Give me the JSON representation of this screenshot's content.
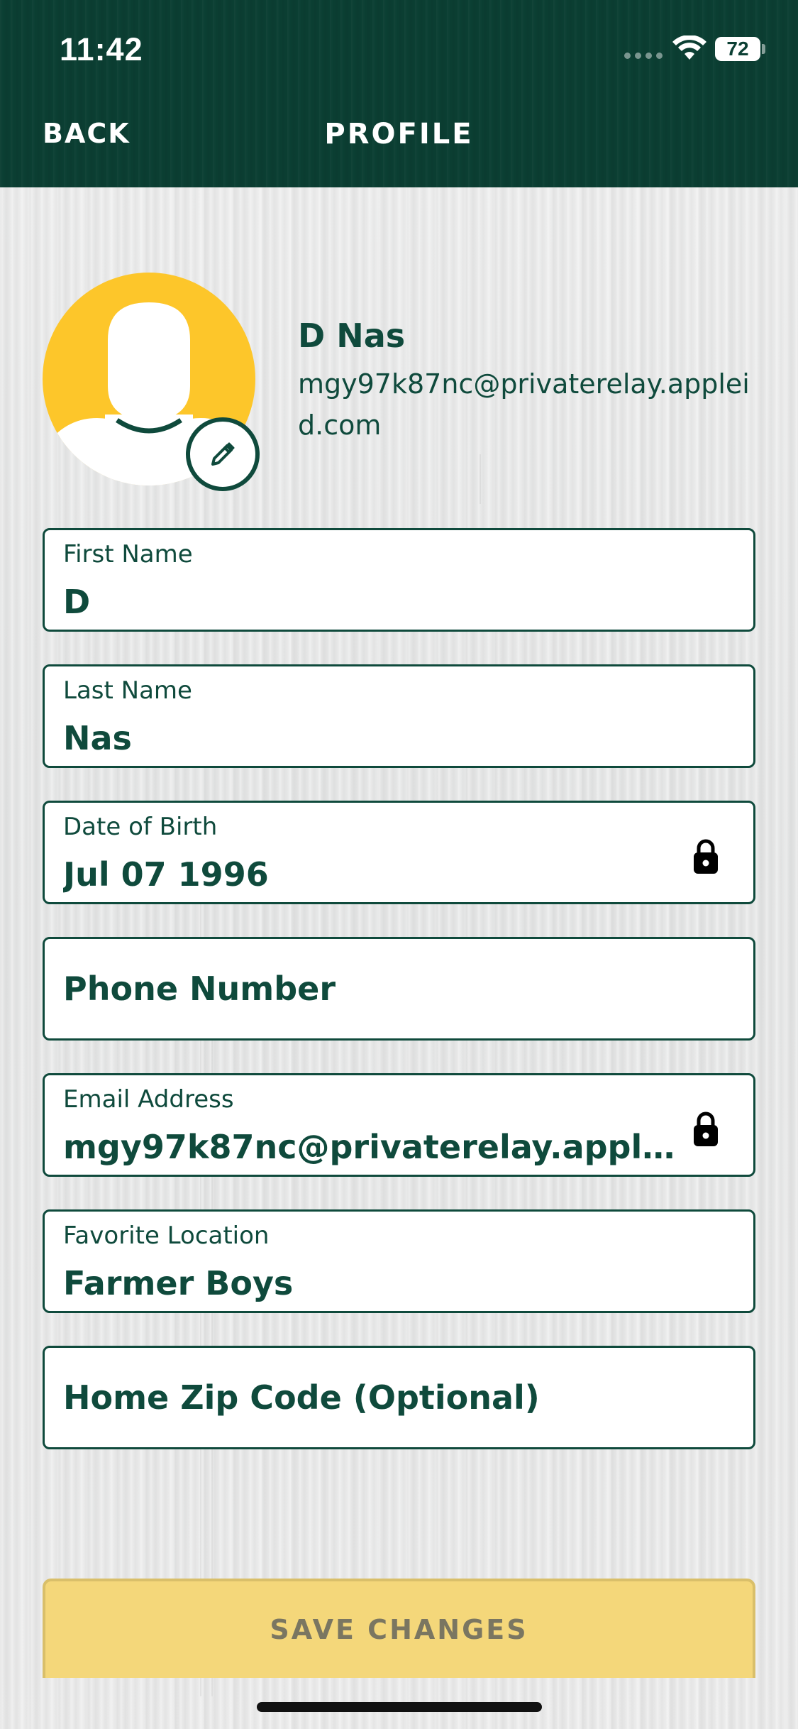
{
  "status_bar": {
    "time": "11:42",
    "battery": "72",
    "signal_icon": "cellular-signal-icon",
    "wifi_icon": "wifi-icon"
  },
  "nav": {
    "back_label": "BACK",
    "title": "PROFILE"
  },
  "profile": {
    "name": "D Nas",
    "email": "mgy97k87nc@privaterelay.appleid.com",
    "avatar_icon": "default-avatar-icon",
    "edit_icon": "pencil-icon"
  },
  "fields": {
    "first_name": {
      "label": "First Name",
      "value": "D"
    },
    "last_name": {
      "label": "Last Name",
      "value": "Nas"
    },
    "dob": {
      "label": "Date of Birth",
      "value": "Jul 07 1996",
      "locked": true
    },
    "phone": {
      "placeholder": "Phone Number"
    },
    "email": {
      "label": "Email Address",
      "value": "mgy97k87nc@privaterelay.appleid.com",
      "locked": true
    },
    "favorite_location": {
      "label": "Favorite Location",
      "value": "Farmer Boys"
    },
    "zip": {
      "placeholder": "Home Zip Code (Optional)"
    }
  },
  "actions": {
    "save_label": "SAVE CHANGES"
  },
  "colors": {
    "brand_green": "#0f4a3c",
    "accent_yellow": "#fdc62a",
    "save_button_disabled": "#f4d77a"
  }
}
